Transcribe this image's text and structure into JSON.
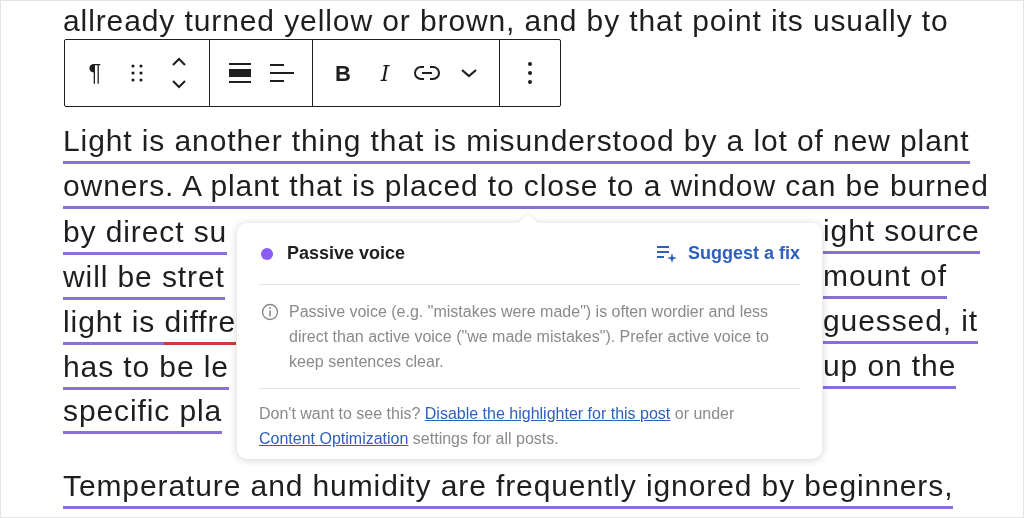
{
  "editor": {
    "paragraphs": [
      {
        "lines": [
          {
            "segments": [
              {
                "text": "allready turned yellow or brown, and by that point its usually to",
                "flagged": false,
                "misspelled": false
              }
            ]
          }
        ]
      },
      {
        "lines": [
          {
            "segments": [
              {
                "text": "Light is another thing that is misunderstood by a lot of new plant",
                "flagged": true,
                "misspelled": false
              }
            ]
          },
          {
            "segments": [
              {
                "text": "owners. A plant that is placed to close to a window can be burned",
                "flagged": true,
                "misspelled": false
              }
            ]
          },
          {
            "segments": [
              {
                "text": "by direct su",
                "flagged": true,
                "misspelled": false
              }
            ],
            "right": [
              {
                "text": "ight source",
                "flagged": true,
                "misspelled": false
              }
            ]
          },
          {
            "segments": [
              {
                "text": "will be stret",
                "flagged": true,
                "misspelled": false
              }
            ],
            "right": [
              {
                "text": "mount of",
                "flagged": true,
                "misspelled": false
              }
            ]
          },
          {
            "segments": [
              {
                "text": "light is ",
                "flagged": true,
                "misspelled": false
              },
              {
                "text": "diffre",
                "flagged": false,
                "misspelled": true
              }
            ],
            "right": [
              {
                "text": "guessed, it",
                "flagged": true,
                "misspelled": false
              }
            ]
          },
          {
            "segments": [
              {
                "text": "has to be le",
                "flagged": true,
                "misspelled": false
              }
            ],
            "right": [
              {
                "text": "up on the",
                "flagged": true,
                "misspelled": false
              }
            ]
          },
          {
            "segments": [
              {
                "text": "specific pla",
                "flagged": true,
                "misspelled": false
              }
            ]
          }
        ]
      },
      {
        "lines": [
          {
            "segments": [
              {
                "text": "Temperature and humidity are frequently ignored by beginners,",
                "flagged": true,
                "misspelled": false
              }
            ]
          }
        ]
      }
    ]
  },
  "toolbar": {
    "groups": [
      {
        "buttons": [
          {
            "kind": "glyph",
            "label": "¶"
          },
          {
            "kind": "drag"
          },
          {
            "kind": "move"
          }
        ]
      },
      {
        "buttons": [
          {
            "kind": "block-align"
          },
          {
            "kind": "text-align"
          }
        ]
      },
      {
        "buttons": [
          {
            "kind": "bold",
            "label": "B"
          },
          {
            "kind": "italic",
            "label": "I"
          },
          {
            "kind": "link"
          },
          {
            "kind": "more-chevron"
          }
        ]
      },
      {
        "buttons": [
          {
            "kind": "kebab"
          }
        ]
      }
    ]
  },
  "popover": {
    "title": "Passive voice",
    "color": "#8b5cf6",
    "action": "Suggest a fix",
    "description": "Passive voice (e.g. \"mistakes were made\") is often wordier and less direct than active voice (\"we made mistakes\"). Prefer active voice to keep sentences clear.",
    "footer": [
      {
        "text": "Don't want to see this? ",
        "link": false
      },
      {
        "text": "Disable the highlighter for this post",
        "link": true
      },
      {
        "text": " or under ",
        "link": false
      },
      {
        "text": "Content Optimization",
        "link": true
      },
      {
        "text": " settings for all posts.",
        "link": false
      }
    ]
  }
}
